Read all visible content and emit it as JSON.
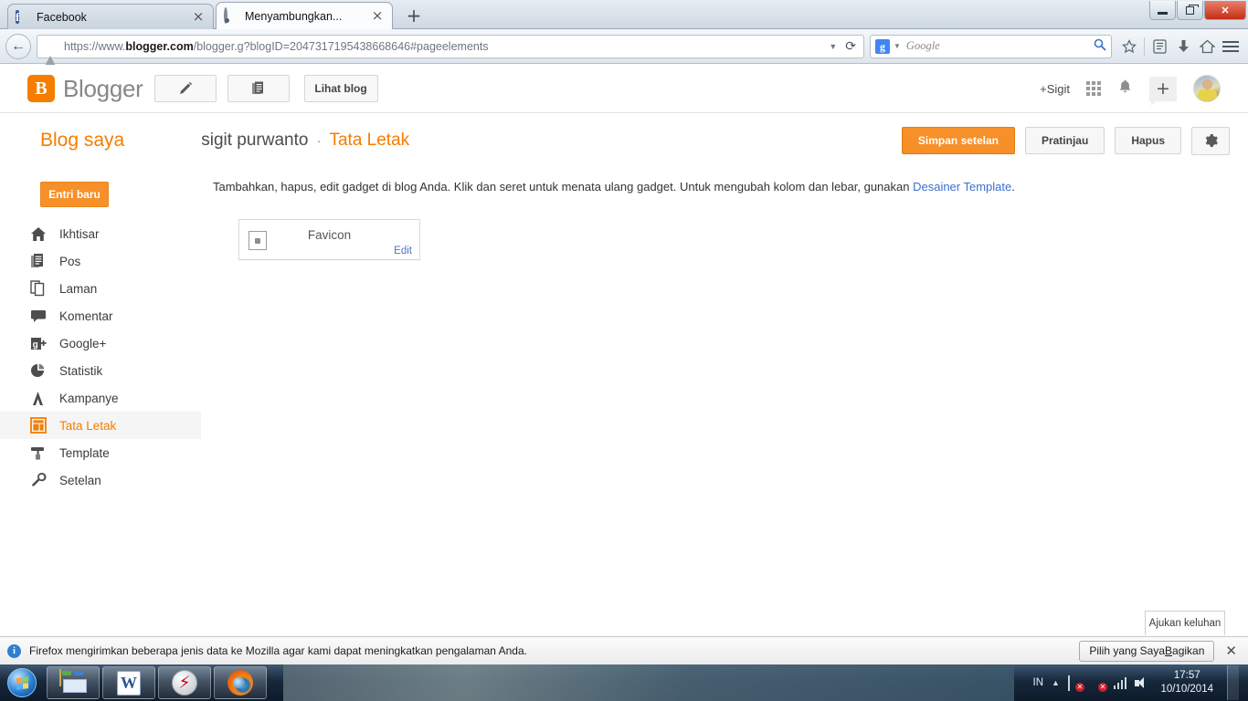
{
  "browser": {
    "tabs": [
      {
        "title": "Facebook",
        "favicon": "facebook-icon",
        "active": false
      },
      {
        "title": "Menyambungkan...",
        "favicon": "loading-spinner-icon",
        "active": true
      }
    ],
    "new_tab_label": "+",
    "url": {
      "scheme": "https://www.",
      "host": "blogger.com",
      "path": "/blogger.g?blogID=2047317195438668646#pageelements"
    },
    "search": {
      "engine": "Google",
      "engine_glyph": "g",
      "placeholder": "Google"
    },
    "window_controls": {
      "minimize": "minimize-icon",
      "restore": "restore-icon",
      "close": "✕"
    }
  },
  "blogger_bar": {
    "wordmark": "Blogger",
    "logo_glyph": "B",
    "new_post_tooltip": "new-post",
    "posts_tooltip": "all-posts",
    "view_blog_label": "Lihat blog",
    "gplus_name": "+Sigit"
  },
  "header": {
    "blog_saya": "Blog saya",
    "blog_name": "sigit purwanto",
    "separator": "·",
    "section": "Tata Letak",
    "save_label": "Simpan setelan",
    "preview_label": "Pratinjau",
    "delete_label": "Hapus"
  },
  "sidebar": {
    "new_entry_label": "Entri baru",
    "items": [
      {
        "label": "Ikhtisar",
        "icon": "home-icon",
        "active": false
      },
      {
        "label": "Pos",
        "icon": "post-icon",
        "active": false
      },
      {
        "label": "Laman",
        "icon": "pages-icon",
        "active": false
      },
      {
        "label": "Komentar",
        "icon": "comment-icon",
        "active": false
      },
      {
        "label": "Google+",
        "icon": "google-plus-icon",
        "active": false
      },
      {
        "label": "Statistik",
        "icon": "pie-chart-icon",
        "active": false
      },
      {
        "label": "Kampanye",
        "icon": "megaphone-icon",
        "active": false
      },
      {
        "label": "Tata Letak",
        "icon": "layout-icon",
        "active": true
      },
      {
        "label": "Template",
        "icon": "paint-roller-icon",
        "active": false
      },
      {
        "label": "Setelan",
        "icon": "wrench-icon",
        "active": false
      }
    ]
  },
  "main": {
    "description_part1": "Tambahkan, hapus, edit gadget di blog Anda. Klik dan seret untuk menata ulang gadget. Untuk mengubah kolom dan lebar, gunakan ",
    "description_link": "Desainer Template",
    "description_part2": ".",
    "gadget": {
      "title": "Favicon",
      "edit_label": "Edit"
    }
  },
  "feedback": {
    "tooltip_label": "Ajukan keluhan"
  },
  "notification": {
    "text": "Firefox mengirimkan beberapa jenis data ke Mozilla agar kami dapat meningkatkan pengalaman Anda.",
    "button_pre": "Pilih yang Saya ",
    "button_underlined": "B",
    "button_post": "agikan",
    "close": "✕",
    "info_glyph": "i"
  },
  "taskbar": {
    "start": "start-orb",
    "items": [
      {
        "name": "windows-explorer",
        "icon": "folder-icon"
      },
      {
        "name": "microsoft-word",
        "icon": "word-icon"
      },
      {
        "name": "smadav",
        "icon": "lightning-icon"
      },
      {
        "name": "firefox",
        "icon": "firefox-icon"
      }
    ],
    "tray": {
      "language": "IN",
      "time": "17:57",
      "date": "10/10/2014"
    }
  },
  "colors": {
    "accent_orange": "#f57d00",
    "button_orange": "#f79029",
    "link_blue": "#3b6fd4",
    "sidebar_active_bg": "#f5f5f5"
  }
}
